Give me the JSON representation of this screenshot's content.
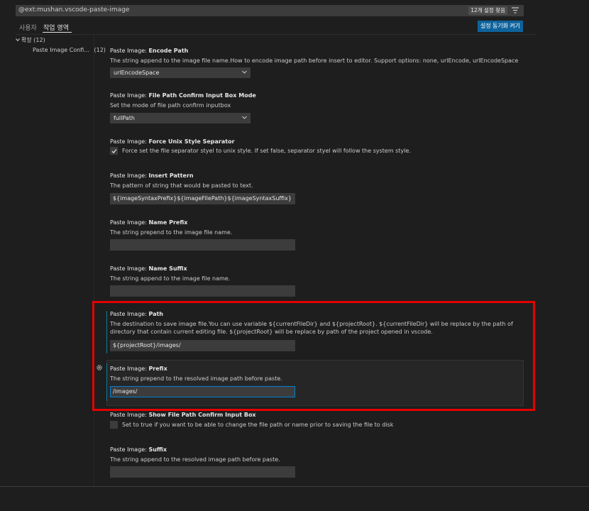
{
  "search": {
    "query": "@ext:mushan.vscode-paste-image",
    "count_badge": "12개 설정 찾음"
  },
  "tabs": [
    {
      "label": "사용자",
      "active": false
    },
    {
      "label": "작업 영역",
      "active": true
    }
  ],
  "sync_button": "설정 동기화 켜기",
  "tree": {
    "extension_label": "확장 (12)",
    "child_label": "Paste Image Confi...",
    "child_count": "(12)"
  },
  "settings": {
    "encode_path": {
      "category": "Paste Image: ",
      "name": "Encode Path",
      "description": "The string append to the image file name.How to encode image path before insert to editor. Support options: none, urlEncode, urlEncodeSpace",
      "value": "urlEncodeSpace"
    },
    "file_path_confirm": {
      "category": "Paste Image: ",
      "name": "File Path Confirm Input Box Mode",
      "description": "Set the mode of file path confirm inputbox",
      "value": "fullPath"
    },
    "force_unix": {
      "category": "Paste Image: ",
      "name": "Force Unix Style Separator",
      "description": "Force set the file separator styel to unix style. If set false, separator styel will follow the system style.",
      "checked": true
    },
    "insert_pattern": {
      "category": "Paste Image: ",
      "name": "Insert Pattern",
      "description": "The pattern of string that would be pasted to text.",
      "value": "${imageSyntaxPrefix}${imageFilePath}${imageSyntaxSuffix}"
    },
    "name_prefix": {
      "category": "Paste Image: ",
      "name": "Name Prefix",
      "description": "The string prepend to the image file name.",
      "value": ""
    },
    "name_suffix": {
      "category": "Paste Image: ",
      "name": "Name Suffix",
      "description": "The string append to the image file name.",
      "value": ""
    },
    "path": {
      "category": "Paste Image: ",
      "name": "Path",
      "description": "The destination to save image file.You can use variable ${currentFileDir} and ${projectRoot}. ${currentFileDir} will be replace by the path of directory that contain current editing file. ${projectRoot} will be replace by path of the project opened in vscode.",
      "value": "${projectRoot}/images/"
    },
    "prefix": {
      "category": "Paste Image: ",
      "name": "Prefix",
      "description": "The string prepend to the resolved image path before paste.",
      "value": "/images/"
    },
    "show_confirm": {
      "category": "Paste Image: ",
      "name": "Show File Path Confirm Input Box",
      "description": "Set to true if you want to be able to change the file path or name prior to saving the file to disk",
      "checked": false
    },
    "suffix": {
      "category": "Paste Image: ",
      "name": "Suffix",
      "description": "The string append to the resolved image path before paste.",
      "value": ""
    }
  },
  "colors": {
    "accent": "#0e639c",
    "focus_border": "#007fd4",
    "highlight_annotation": "#e50000"
  }
}
